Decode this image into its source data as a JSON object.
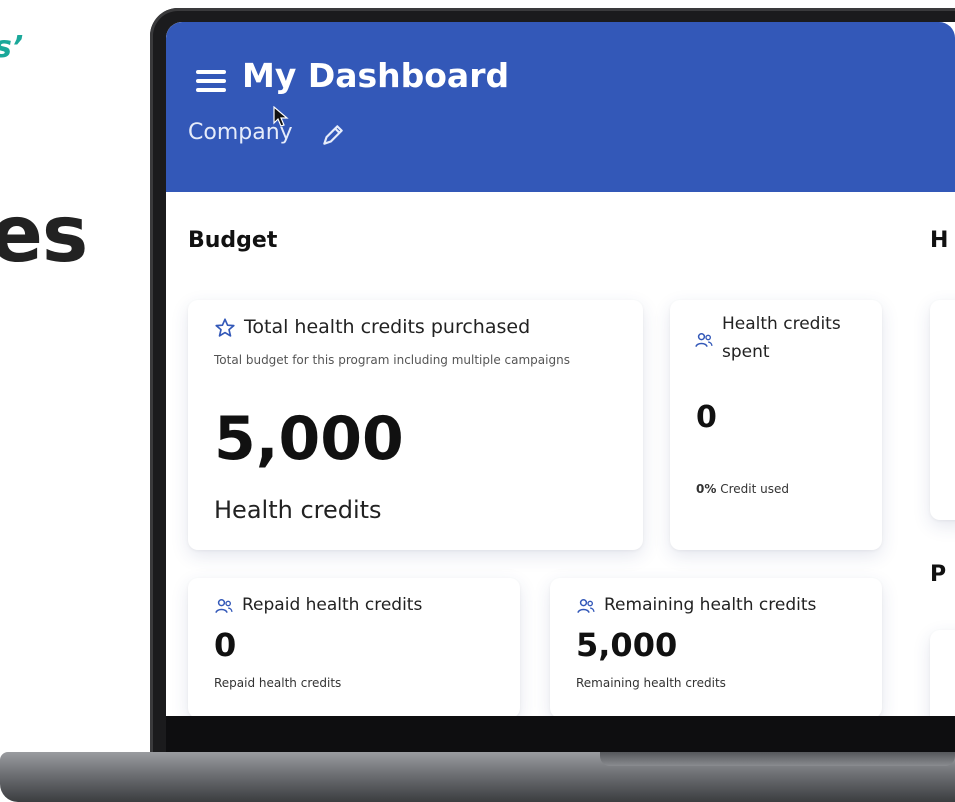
{
  "marketing": {
    "fragment_top": "s’",
    "fragment_big": "es"
  },
  "app": {
    "title": "My Dashboard",
    "company_label": "Company"
  },
  "budget": {
    "section_title": "Budget",
    "total_card": {
      "title": "Total health credits purchased",
      "description": "Total budget for this program including multiple campaigns",
      "value": "5,000",
      "unit": "Health credits"
    },
    "spent_card": {
      "title_line1": "Health credits",
      "title_line2": "spent",
      "value": "0",
      "percent": "0%",
      "percent_label": "Credit used"
    },
    "repaid_card": {
      "title": "Repaid health credits",
      "value": "0",
      "caption": "Repaid health credits"
    },
    "remaining_card": {
      "title": "Remaining health credits",
      "value": "5,000",
      "caption": "Remaining health credits"
    }
  },
  "right_column": {
    "section_h": "H",
    "section_p": "P"
  },
  "colors": {
    "header_blue": "#3358b8",
    "icon_blue": "#3358b8",
    "teal": "#1aa89a"
  },
  "icons": [
    "menu-icon",
    "pencil-icon",
    "star-icon",
    "users-icon",
    "cursor-icon"
  ]
}
